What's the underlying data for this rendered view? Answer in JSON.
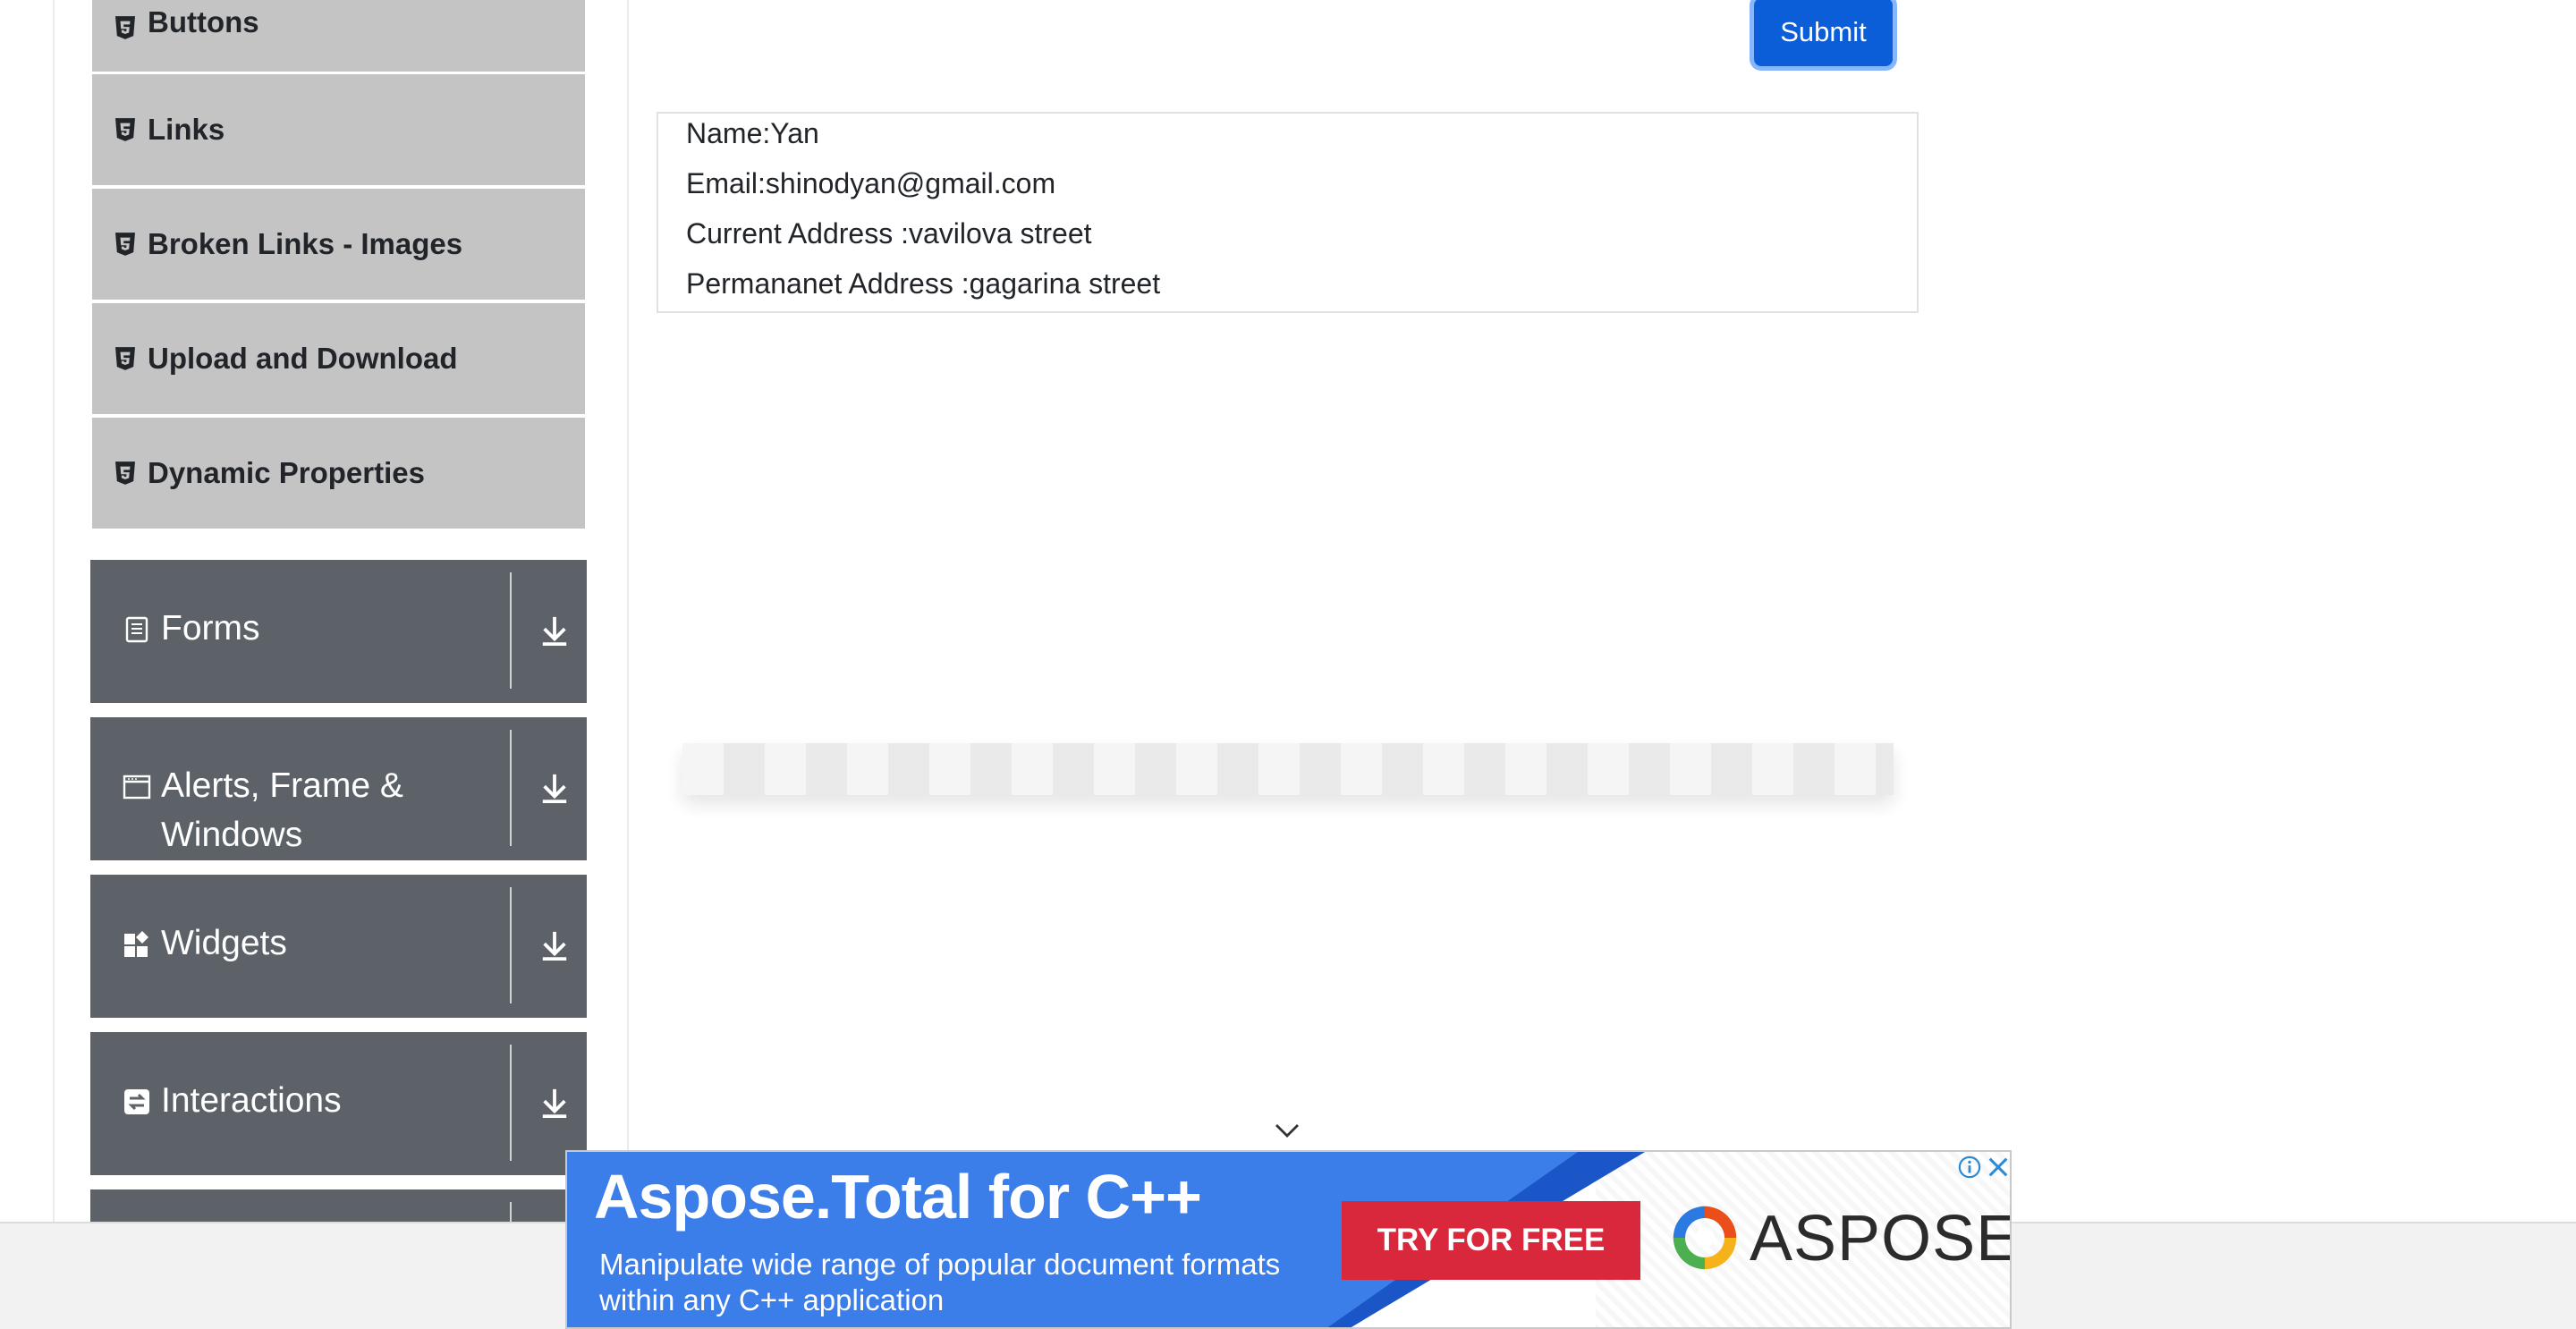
{
  "sidebar": {
    "elements": [
      {
        "label": "Buttons"
      },
      {
        "label": "Links"
      },
      {
        "label": "Broken Links - Images"
      },
      {
        "label": "Upload and Download"
      },
      {
        "label": "Dynamic Properties"
      }
    ],
    "groups": [
      {
        "label": "Forms",
        "icon": "form-icon"
      },
      {
        "label_line1": "Alerts, Frame &",
        "label_line2": "Windows",
        "icon": "window-icon"
      },
      {
        "label": "Widgets",
        "icon": "widgets-icon"
      },
      {
        "label": "Interactions",
        "icon": "interactions-icon"
      }
    ]
  },
  "form": {
    "submit_label": "Submit"
  },
  "output": {
    "name": "Name:Yan",
    "email": "Email:shinodyan@gmail.com",
    "current_address": "Current Address :vavilova street",
    "permanent_address": "Permananet Address :gagarina street"
  },
  "ad": {
    "title": "Aspose.Total for C++",
    "subtitle_line1": "Manipulate wide range of popular document formats",
    "subtitle_line2": "within any C++ application",
    "cta": "TRY FOR FREE",
    "brand": "ASPOSE"
  },
  "colors": {
    "group_bg": "#5c6268",
    "element_bg": "#c4c4c4",
    "submit_bg": "#0b5ed7",
    "ad_blue": "#3b7de9",
    "ad_red": "#d9283b"
  }
}
